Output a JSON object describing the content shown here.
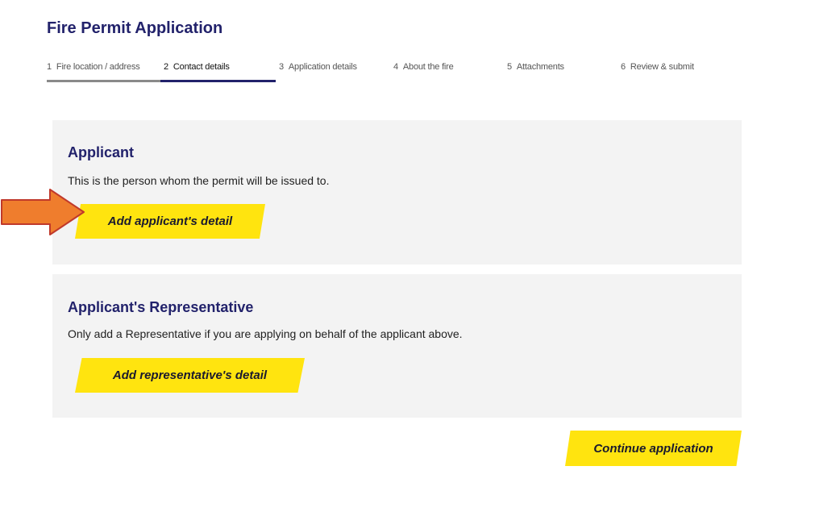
{
  "page": {
    "title": "Fire Permit Application"
  },
  "steps": [
    {
      "num": "1",
      "label": "Fire location / address"
    },
    {
      "num": "2",
      "label": "Contact details"
    },
    {
      "num": "3",
      "label": "Application details"
    },
    {
      "num": "4",
      "label": "About the fire"
    },
    {
      "num": "5",
      "label": "Attachments"
    },
    {
      "num": "6",
      "label": "Review & submit"
    }
  ],
  "active_step": "2",
  "applicant": {
    "title": "Applicant",
    "description": "This is the person whom the permit will be issued to.",
    "button_label": "Add applicant's detail"
  },
  "representative": {
    "title": "Applicant's Representative",
    "description": "Only add a Representative if you are applying on behalf of the applicant above.",
    "button_label": "Add representative's detail"
  },
  "continue_label": "Continue application",
  "colors": {
    "brand_navy": "#22226b",
    "button_yellow": "#ffe40f",
    "card_bg": "#f3f3f3",
    "annotation_arrow": "#ef7d2d"
  },
  "annotation": {
    "icon": "arrow-right-icon"
  }
}
